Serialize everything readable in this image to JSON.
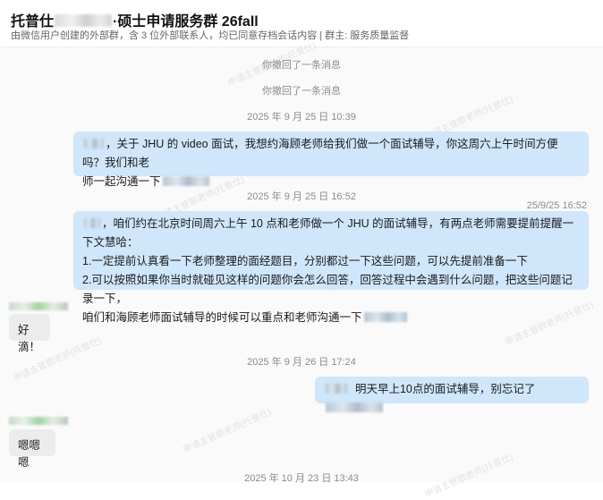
{
  "header": {
    "title_start": "托普仕",
    "title_end": "·硕士申请服务群 26fall",
    "subtitle": "由微信用户创建的外部群，含 3 位外部联系人，均已同意存档会话内容 | 群主: 服务质量监督"
  },
  "messages": {
    "recall_1": "你撤回了一条消息",
    "recall_2": "你撤回了一条消息",
    "time_1": "2025 年 9 月 25 日 10:39",
    "msg_1_line1": "，关于 JHU 的 video 面试，我想约海顾老师给我们做一个面试辅导，你这周六上午时间方便吗？我们和老",
    "msg_1_line2": "师一起沟通一下",
    "time_2": "2025 年 9 月 25 日 16:52",
    "edited_time": "25/9/25 16:52",
    "msg_2_line1": "，咱们约在北京时间周六上午 10 点和老师做一个 JHU 的面试辅导，有两点老师需要提前提醒一下文慧哈：",
    "msg_2_line2": "1.一定提前认真看一下老师整理的面经题目，分别都过一下这些问题，可以先提前准备一下",
    "msg_2_line3": "2.可以按照如果你当时就碰见这样的问题你会怎么回答，回答过程中会遇到什么问题，把这些问题记录一下，",
    "msg_2_line4": "咱们和海顾老师面试辅导的时候可以重点和老师沟通一下",
    "reply_1": "好滴！",
    "time_3": "2025 年 9 月 26 日 17:24",
    "msg_3": "明天早上10点的面试辅导，别忘记了",
    "reply_2": "嗯嗯嗯",
    "time_4": "2025 年 10 月 23 日 13:43"
  },
  "watermark": "申请主管歌老师(托普仕)",
  "colors": {
    "outgoing_bubble": "#cfe6fb",
    "incoming_bubble": "#ececec"
  }
}
